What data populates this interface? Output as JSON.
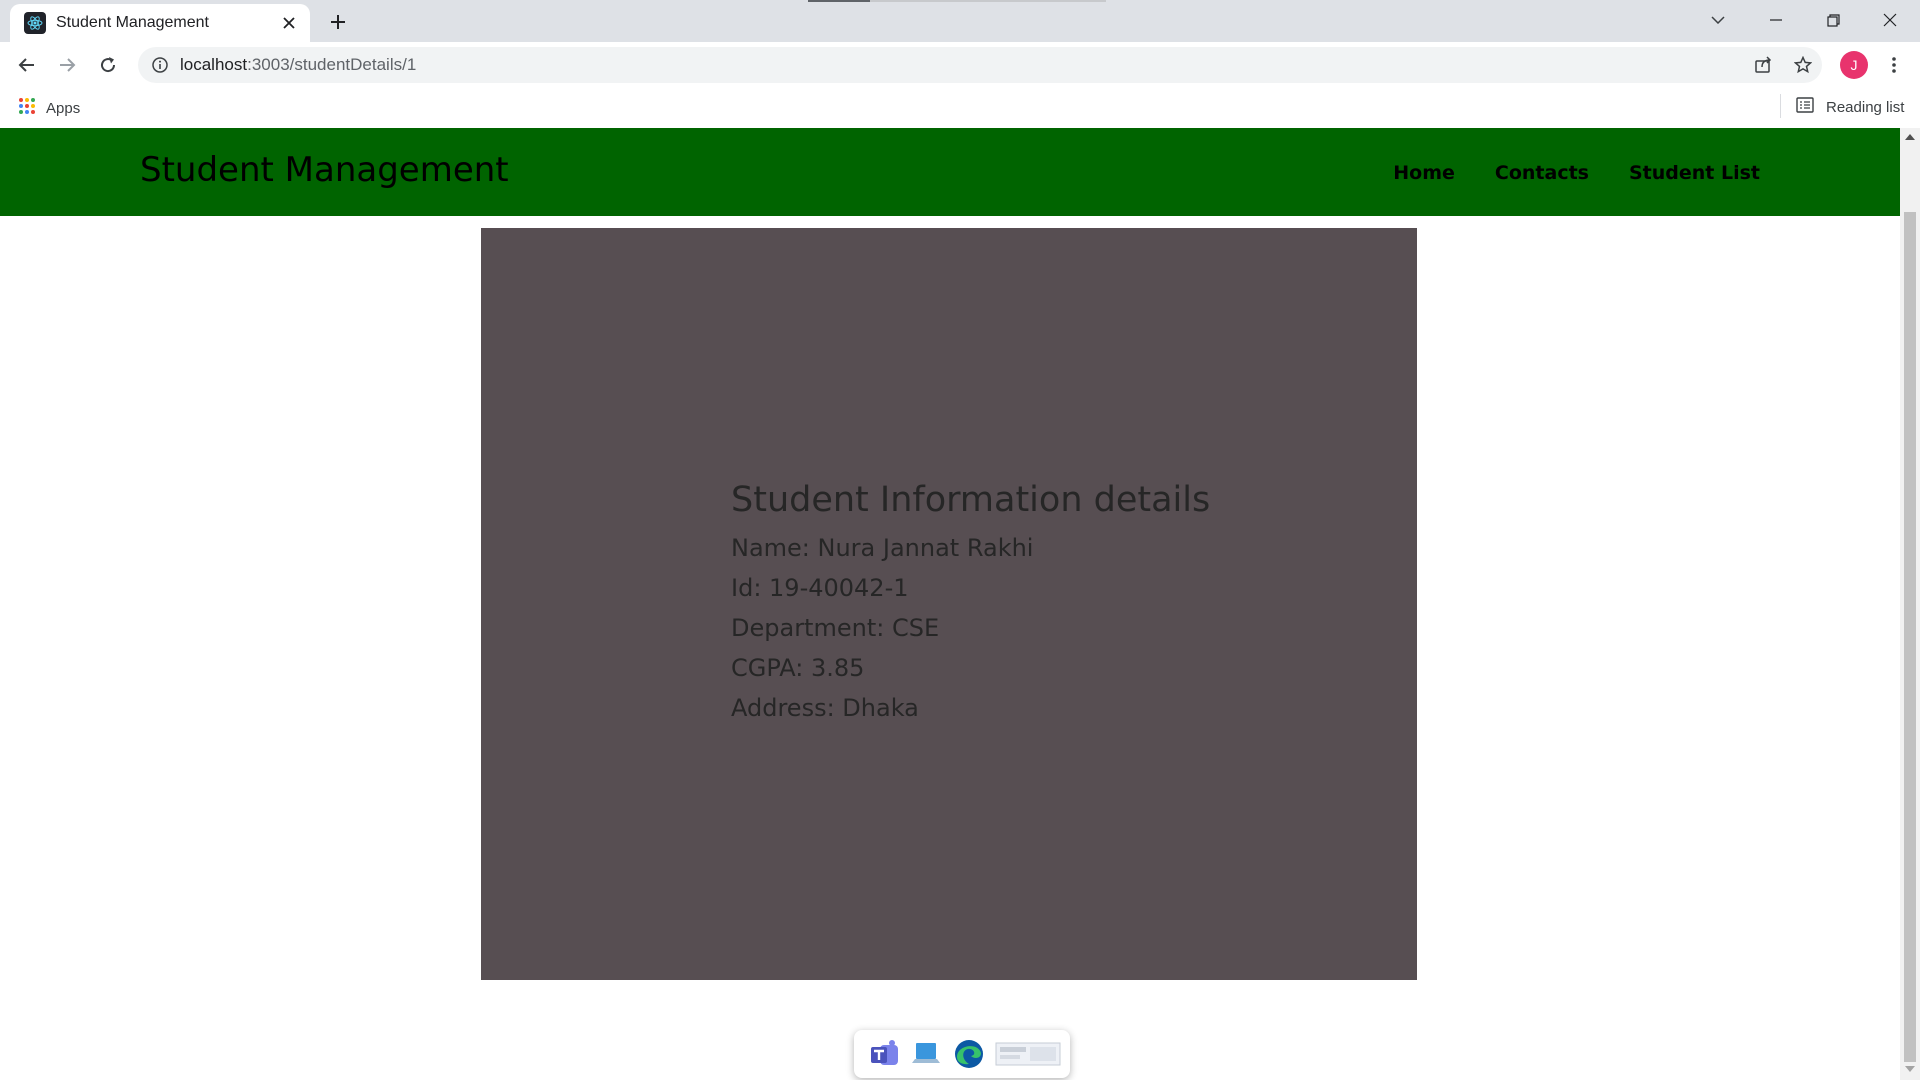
{
  "browser": {
    "tab_title": "Student Management",
    "url_host": "localhost",
    "url_path": ":3003/studentDetails/1",
    "profile_initial": "J",
    "bookmarks": {
      "apps_label": "Apps",
      "reading_list_label": "Reading list"
    }
  },
  "page": {
    "brand": "Student Management",
    "nav": [
      {
        "label": "Home"
      },
      {
        "label": "Contacts"
      },
      {
        "label": "Student List"
      }
    ],
    "details": {
      "title": "Student Information details",
      "name": "Name: Nura Jannat Rakhi",
      "id": "Id: 19-40042-1",
      "department": "Department: CSE",
      "cgpa": "CGPA: 3.85",
      "address": "Address: Dhaka"
    }
  },
  "colors": {
    "navbar": "#006400",
    "card": "#574e52",
    "avatar": "#e8336d"
  },
  "icons": [
    "react-favicon",
    "close-icon",
    "plus-icon",
    "chevron-down-icon",
    "minimize-icon",
    "restore-icon",
    "back-arrow-icon",
    "forward-arrow-icon",
    "reload-icon",
    "info-icon",
    "share-icon",
    "star-icon",
    "kebab-menu-icon",
    "apps-grid-icon",
    "reading-list-icon",
    "teams-icon",
    "edge-icon"
  ]
}
